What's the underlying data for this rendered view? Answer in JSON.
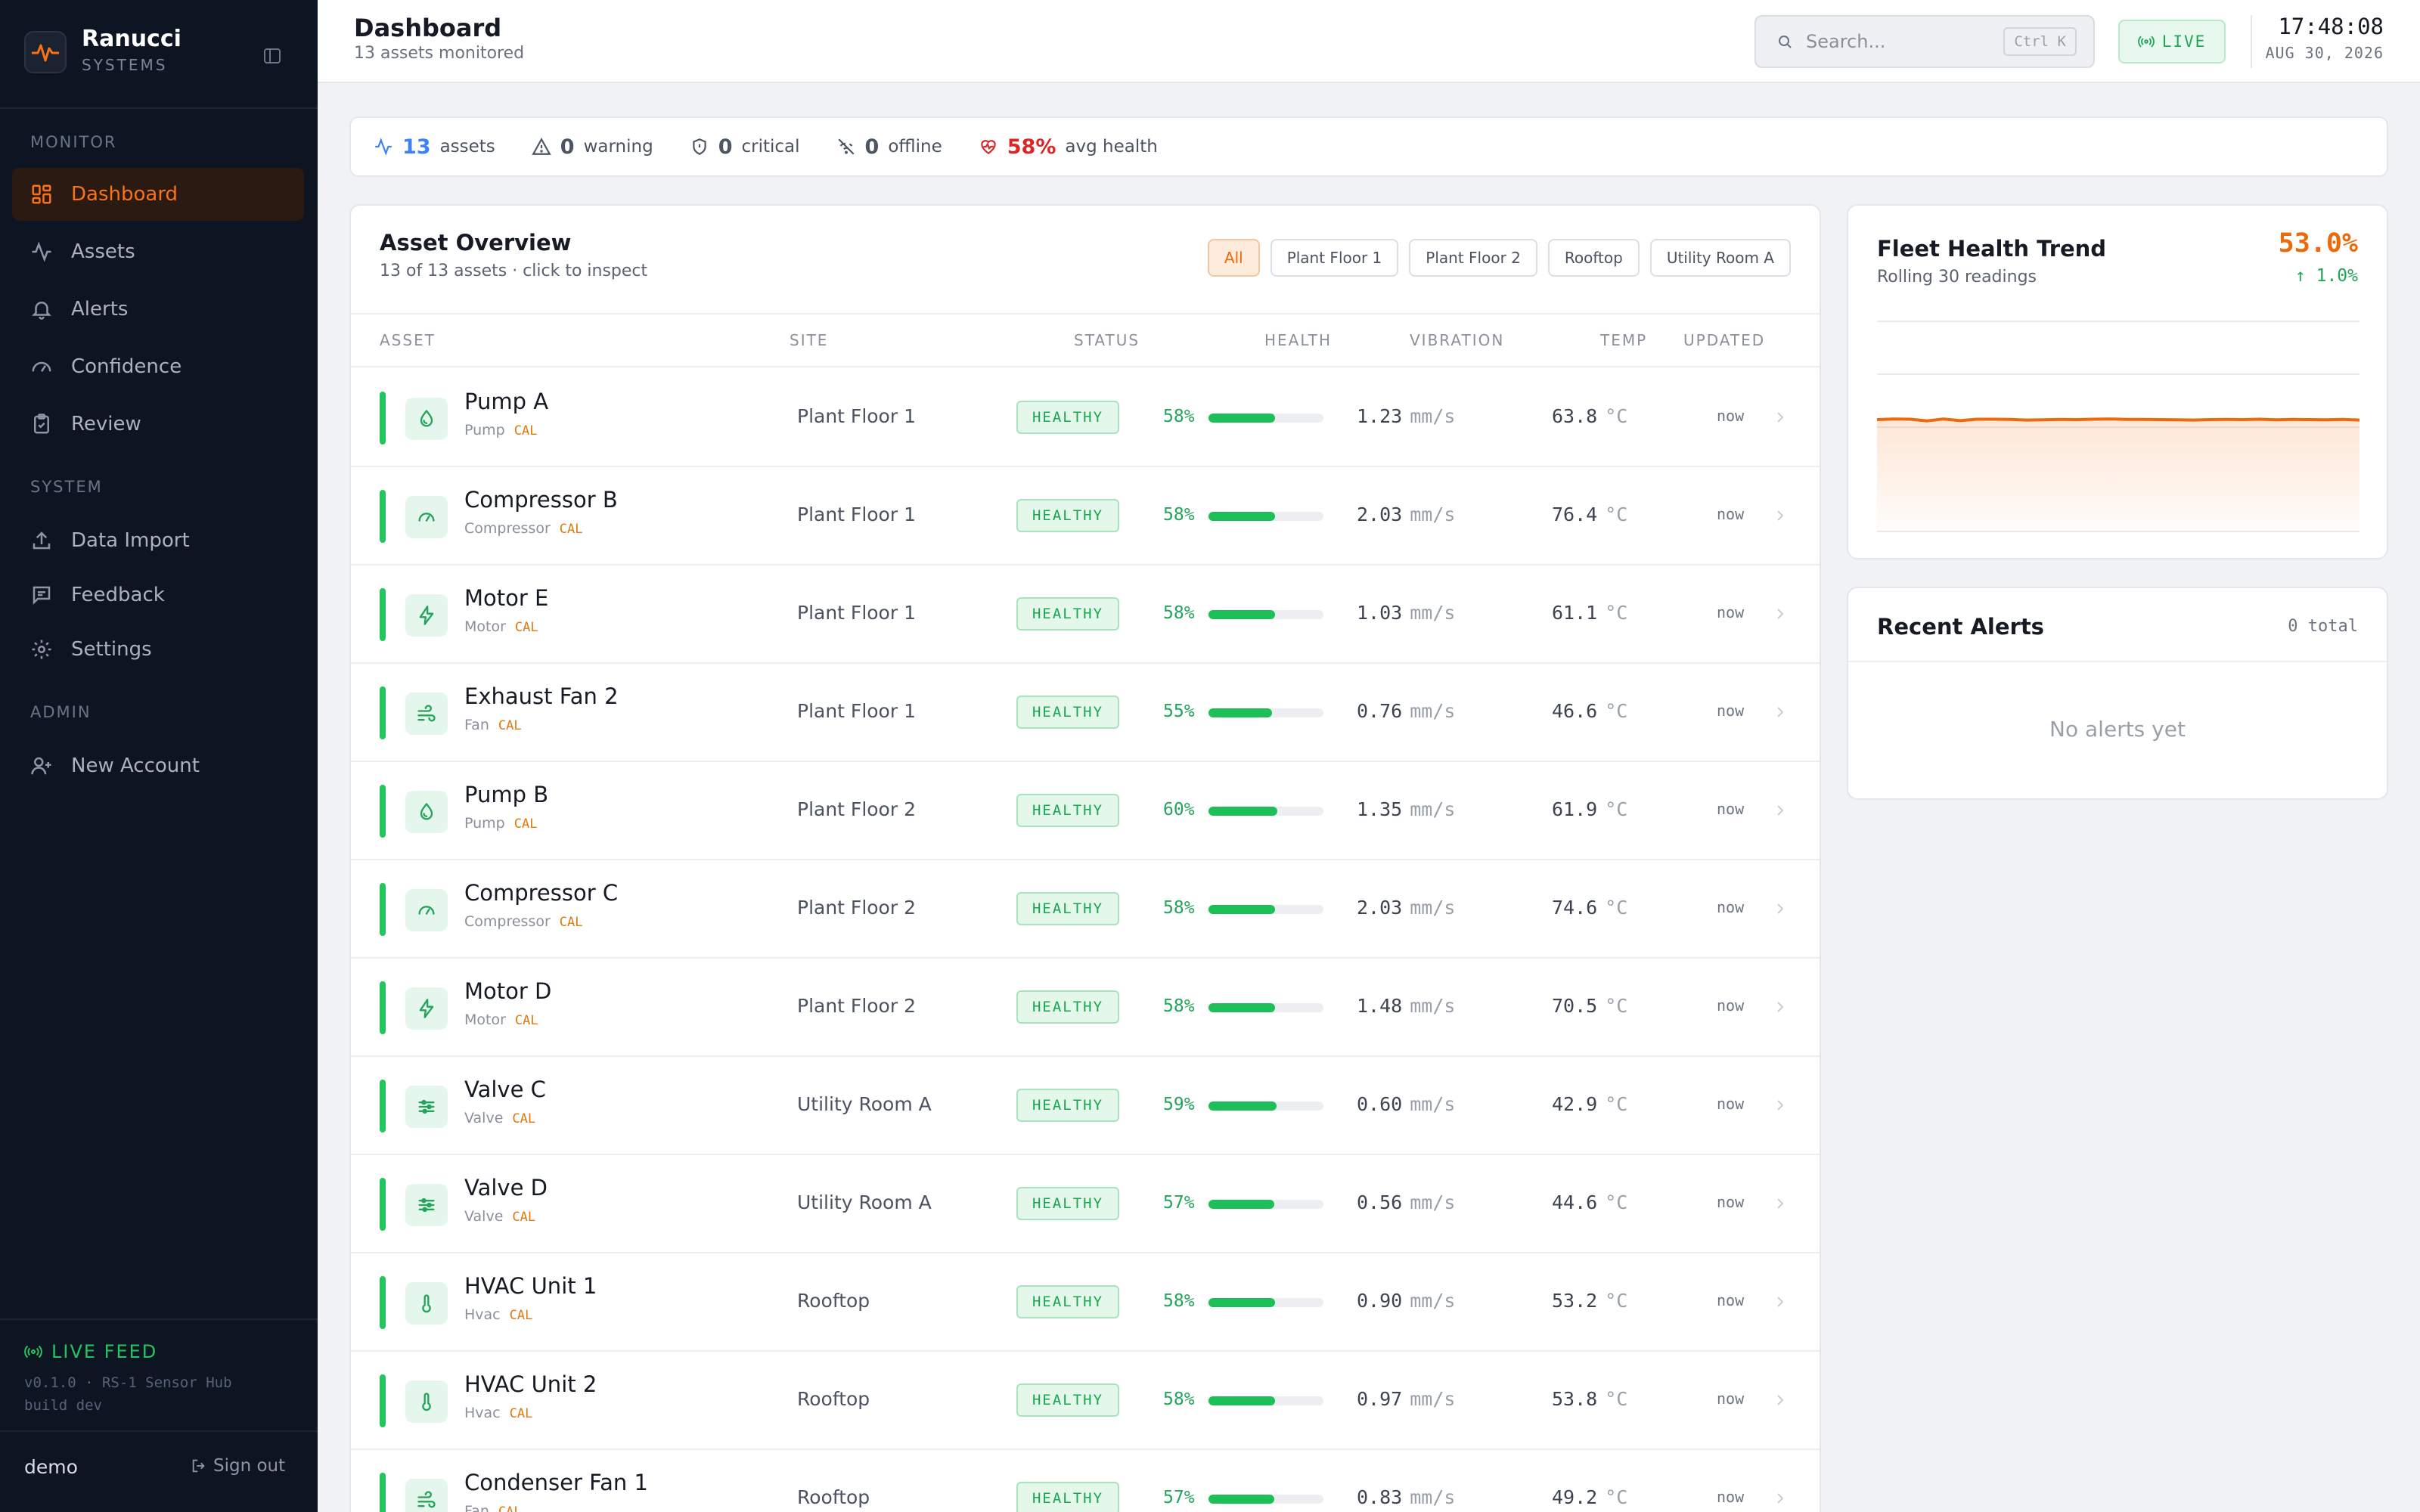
{
  "brand": {
    "name": "Ranucci",
    "sub": "SYSTEMS"
  },
  "sidebar": {
    "sections": [
      {
        "title": "MONITOR",
        "items": [
          {
            "label": "Dashboard",
            "icon": "grid-icon",
            "active": true
          },
          {
            "label": "Assets",
            "icon": "activity-icon"
          },
          {
            "label": "Alerts",
            "icon": "bell-icon"
          },
          {
            "label": "Confidence",
            "icon": "gauge-icon"
          },
          {
            "label": "Review",
            "icon": "clipboard-check-icon"
          }
        ]
      },
      {
        "title": "SYSTEM",
        "items": [
          {
            "label": "Data Import",
            "icon": "upload-icon"
          },
          {
            "label": "Feedback",
            "icon": "message-icon"
          },
          {
            "label": "Settings",
            "icon": "gear-icon"
          }
        ]
      },
      {
        "title": "ADMIN",
        "items": [
          {
            "label": "New Account",
            "icon": "user-plus-icon"
          }
        ]
      }
    ],
    "live_feed": "LIVE FEED",
    "version_line1": "v0.1.0 · RS-1 Sensor Hub",
    "version_line2": "build dev",
    "user": "demo",
    "signout": "Sign out"
  },
  "header": {
    "title": "Dashboard",
    "subtitle": "13 assets monitored",
    "search_placeholder": "Search...",
    "search_shortcut": "Ctrl K",
    "live_label": "LIVE",
    "time": "17:48:08",
    "date": "AUG 30, 2026"
  },
  "stats": [
    {
      "value": "13",
      "label": "assets",
      "icon": "activity-icon",
      "color": "#3b82f6"
    },
    {
      "value": "0",
      "label": "warning",
      "icon": "warning-icon",
      "color": "#4b5563"
    },
    {
      "value": "0",
      "label": "critical",
      "icon": "shield-icon",
      "color": "#4b5563"
    },
    {
      "value": "0",
      "label": "offline",
      "icon": "wifi-off-icon",
      "color": "#4b5563"
    },
    {
      "value": "58%",
      "label": "avg health",
      "icon": "heart-pulse-icon",
      "color": "#dc2626"
    }
  ],
  "overview": {
    "title": "Asset Overview",
    "subtitle": "13 of 13 assets · click to inspect",
    "filters": [
      "All",
      "Plant Floor 1",
      "Plant Floor 2",
      "Rooftop",
      "Utility Room A"
    ],
    "active_filter": "All",
    "columns": [
      "ASSET",
      "SITE",
      "STATUS",
      "HEALTH",
      "VIBRATION",
      "TEMP",
      "UPDATED"
    ],
    "cal_label": "CAL",
    "vib_unit": "mm/s",
    "temp_unit": "°C",
    "rows": [
      {
        "name": "Pump A",
        "type": "Pump",
        "icon": "droplet-icon",
        "site": "Plant Floor 1",
        "status": "HEALTHY",
        "health": 58,
        "health_label": "58%",
        "vibration": "1.23",
        "temp": "63.8",
        "updated": "now"
      },
      {
        "name": "Compressor B",
        "type": "Compressor",
        "icon": "gauge-icon",
        "site": "Plant Floor 1",
        "status": "HEALTHY",
        "health": 58,
        "health_label": "58%",
        "vibration": "2.03",
        "temp": "76.4",
        "updated": "now"
      },
      {
        "name": "Motor E",
        "type": "Motor",
        "icon": "bolt-icon",
        "site": "Plant Floor 1",
        "status": "HEALTHY",
        "health": 58,
        "health_label": "58%",
        "vibration": "1.03",
        "temp": "61.1",
        "updated": "now"
      },
      {
        "name": "Exhaust Fan 2",
        "type": "Fan",
        "icon": "wind-icon",
        "site": "Plant Floor 1",
        "status": "HEALTHY",
        "health": 55,
        "health_label": "55%",
        "vibration": "0.76",
        "temp": "46.6",
        "updated": "now"
      },
      {
        "name": "Pump B",
        "type": "Pump",
        "icon": "droplet-icon",
        "site": "Plant Floor 2",
        "status": "HEALTHY",
        "health": 60,
        "health_label": "60%",
        "vibration": "1.35",
        "temp": "61.9",
        "updated": "now"
      },
      {
        "name": "Compressor C",
        "type": "Compressor",
        "icon": "gauge-icon",
        "site": "Plant Floor 2",
        "status": "HEALTHY",
        "health": 58,
        "health_label": "58%",
        "vibration": "2.03",
        "temp": "74.6",
        "updated": "now"
      },
      {
        "name": "Motor D",
        "type": "Motor",
        "icon": "bolt-icon",
        "site": "Plant Floor 2",
        "status": "HEALTHY",
        "health": 58,
        "health_label": "58%",
        "vibration": "1.48",
        "temp": "70.5",
        "updated": "now"
      },
      {
        "name": "Valve C",
        "type": "Valve",
        "icon": "sliders-icon",
        "site": "Utility Room A",
        "status": "HEALTHY",
        "health": 59,
        "health_label": "59%",
        "vibration": "0.60",
        "temp": "42.9",
        "updated": "now"
      },
      {
        "name": "Valve D",
        "type": "Valve",
        "icon": "sliders-icon",
        "site": "Utility Room A",
        "status": "HEALTHY",
        "health": 57,
        "health_label": "57%",
        "vibration": "0.56",
        "temp": "44.6",
        "updated": "now"
      },
      {
        "name": "HVAC Unit 1",
        "type": "Hvac",
        "icon": "thermometer-icon",
        "site": "Rooftop",
        "status": "HEALTHY",
        "health": 58,
        "health_label": "58%",
        "vibration": "0.90",
        "temp": "53.2",
        "updated": "now"
      },
      {
        "name": "HVAC Unit 2",
        "type": "Hvac",
        "icon": "thermometer-icon",
        "site": "Rooftop",
        "status": "HEALTHY",
        "health": 58,
        "health_label": "58%",
        "vibration": "0.97",
        "temp": "53.8",
        "updated": "now"
      },
      {
        "name": "Condenser Fan 1",
        "type": "Fan",
        "icon": "wind-icon",
        "site": "Rooftop",
        "status": "HEALTHY",
        "health": 57,
        "health_label": "57%",
        "vibration": "0.83",
        "temp": "49.2",
        "updated": "now"
      }
    ]
  },
  "fleet": {
    "title": "Fleet Health Trend",
    "subtitle": "Rolling 30 readings",
    "value": "53.0%",
    "delta": "↑ 1.0%",
    "color": "#ea6a0c"
  },
  "chart_data": {
    "type": "area",
    "title": "Fleet Health Trend",
    "subtitle": "Rolling 30 readings",
    "x": [
      1,
      2,
      3,
      4,
      5,
      6,
      7,
      8,
      9,
      10,
      11,
      12,
      13,
      14,
      15,
      16,
      17,
      18,
      19,
      20,
      21,
      22,
      23,
      24,
      25,
      26,
      27,
      28,
      29,
      30
    ],
    "series": [
      {
        "values": [
          53.2,
          53.5,
          53.4,
          52.6,
          53.5,
          52.7,
          53.4,
          53.4,
          53.3,
          53.0,
          53.1,
          53.3,
          53.2,
          53.4,
          53.5,
          53.3,
          53.3,
          53.2,
          53.1,
          53.0,
          53.2,
          53.3,
          53.2,
          53.4,
          53.1,
          53.3,
          53.2,
          53.1,
          53.3,
          53.0
        ]
      }
    ],
    "ylim": [
      0,
      100
    ],
    "grid": true
  },
  "alerts": {
    "title": "Recent Alerts",
    "total": "0 total",
    "empty": "No alerts yet"
  }
}
